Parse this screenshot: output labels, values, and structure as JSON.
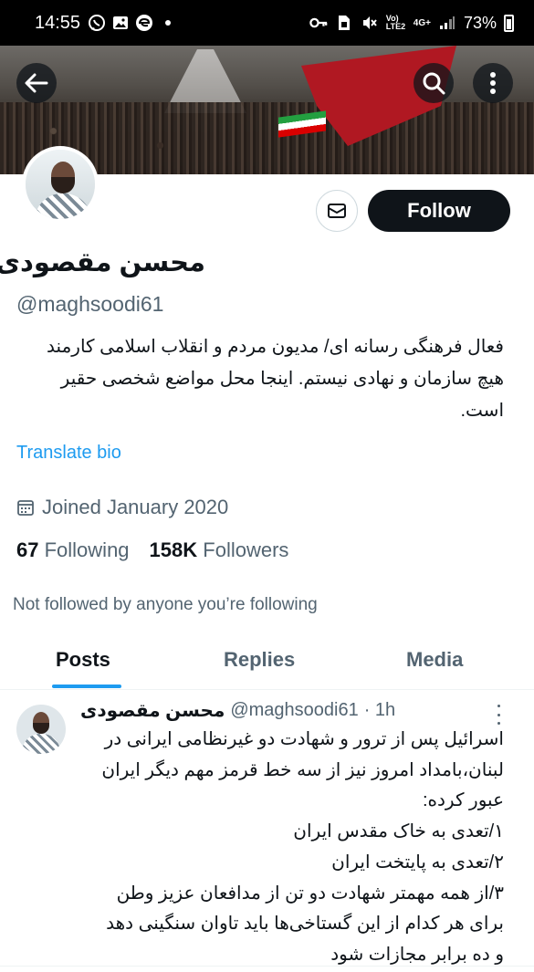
{
  "status_bar": {
    "time": "14:55",
    "battery": "73%",
    "left_icons": [
      "whatsapp-icon",
      "gallery-icon",
      "edge-icon",
      "dot-icon"
    ],
    "right_icons": [
      "key-icon",
      "sim-icon",
      "mute-icon",
      "volte-icon",
      "4g-icon",
      "signal-icon",
      "battery-icon"
    ],
    "volte_text": "Vo) LTE2",
    "network_text": "4G+"
  },
  "profile": {
    "display_name": "محسن مقصودی",
    "handle": "@maghsoodi61",
    "bio_lines": [
      "فعال فرهنگی رسانه ای/ مدیون مردم و انقلاب اسلامی  کارمند",
      "هیچ سازمان و نهادی نیستم. اینجا محل مواضع شخصی حقیر",
      "است."
    ],
    "translate_label": "Translate bio",
    "joined": "Joined January 2020",
    "following_count": "67",
    "following_label": "Following",
    "followers_count": "158K",
    "followers_label": "Followers",
    "not_followed": "Not followed by anyone you’re following"
  },
  "actions": {
    "follow_label": "Follow"
  },
  "tabs": [
    {
      "label": "Posts",
      "active": true
    },
    {
      "label": "Replies",
      "active": false
    },
    {
      "label": "Media",
      "active": false
    }
  ],
  "tweet": {
    "name": "محسن مقصودی",
    "handle": "@maghsoodi61",
    "time": "· 1h",
    "lines": [
      "اسرائیل پس از ترور و شهادت دو غیرنظامی ایرانی در",
      "لبنان،بامداد امروز نیز از سه خط قرمز مهم دیگر ایران",
      "عبور کرده:",
      "۱/تعدی به خاک مقدس ایران",
      "۲/تعدی به پایتخت ایران",
      "۳/از همه مهمتر شهادت دو تن از مدافعان عزیز وطن",
      "برای هر کدام از این گستاخی‌ها باید تاوان سنگینی دهد",
      "و ده برابر مجازات شود"
    ]
  },
  "colors": {
    "accent": "#1d9bf0",
    "text": "#0f1419",
    "secondary": "#536471",
    "follow_bg": "#0f1419"
  }
}
